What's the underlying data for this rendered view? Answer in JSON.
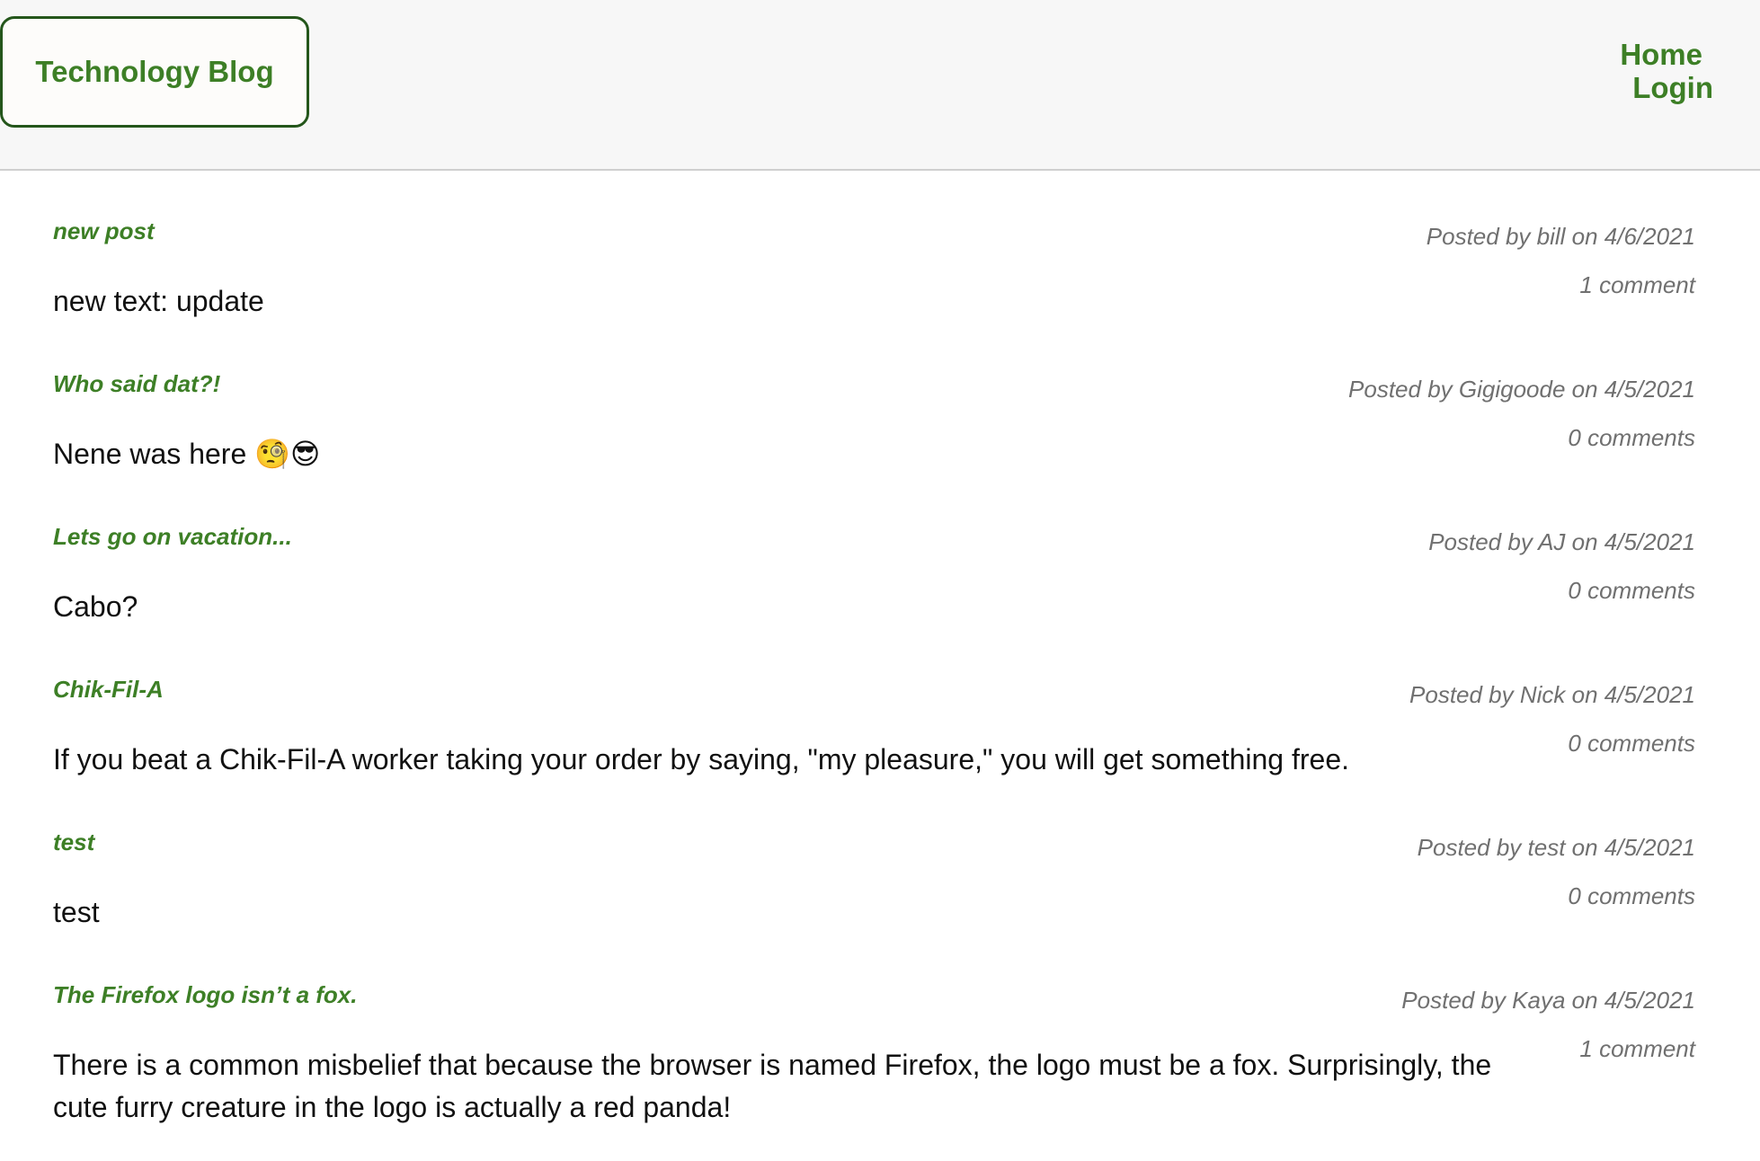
{
  "header": {
    "brand": "Technology Blog",
    "nav": {
      "home": "Home",
      "login": "Login"
    }
  },
  "posts": [
    {
      "title": "new post",
      "meta": "Posted by bill on 4/6/2021",
      "comments": "1 comment",
      "body": "new text: update"
    },
    {
      "title": "Who said dat?!",
      "meta": "Posted by Gigigoode on 4/5/2021",
      "comments": "0 comments",
      "body": "Nene was here 🧐😎"
    },
    {
      "title": "Lets go on vacation...",
      "meta": "Posted by AJ on 4/5/2021",
      "comments": "0 comments",
      "body": "Cabo?"
    },
    {
      "title": "Chik-Fil-A",
      "meta": "Posted by Nick on 4/5/2021",
      "comments": "0 comments",
      "body": "If you beat a Chik-Fil-A worker taking your order by saying, \"my pleasure,\" you will get something free."
    },
    {
      "title": "test",
      "meta": "Posted by test on 4/5/2021",
      "comments": "0 comments",
      "body": "test"
    },
    {
      "title": "The Firefox logo isn’t a fox.",
      "meta": "Posted by Kaya on 4/5/2021",
      "comments": "1 comment",
      "body": "There is a common misbelief that because the browser is named Firefox, the logo must be a fox. Surprisingly, the cute furry creature in the logo is actually a red panda!"
    }
  ],
  "colors": {
    "accent": "#3d7f26",
    "brand_border": "#24561b",
    "header_bg": "#f7f7f7",
    "meta_text": "#707070",
    "body_text": "#111111"
  }
}
